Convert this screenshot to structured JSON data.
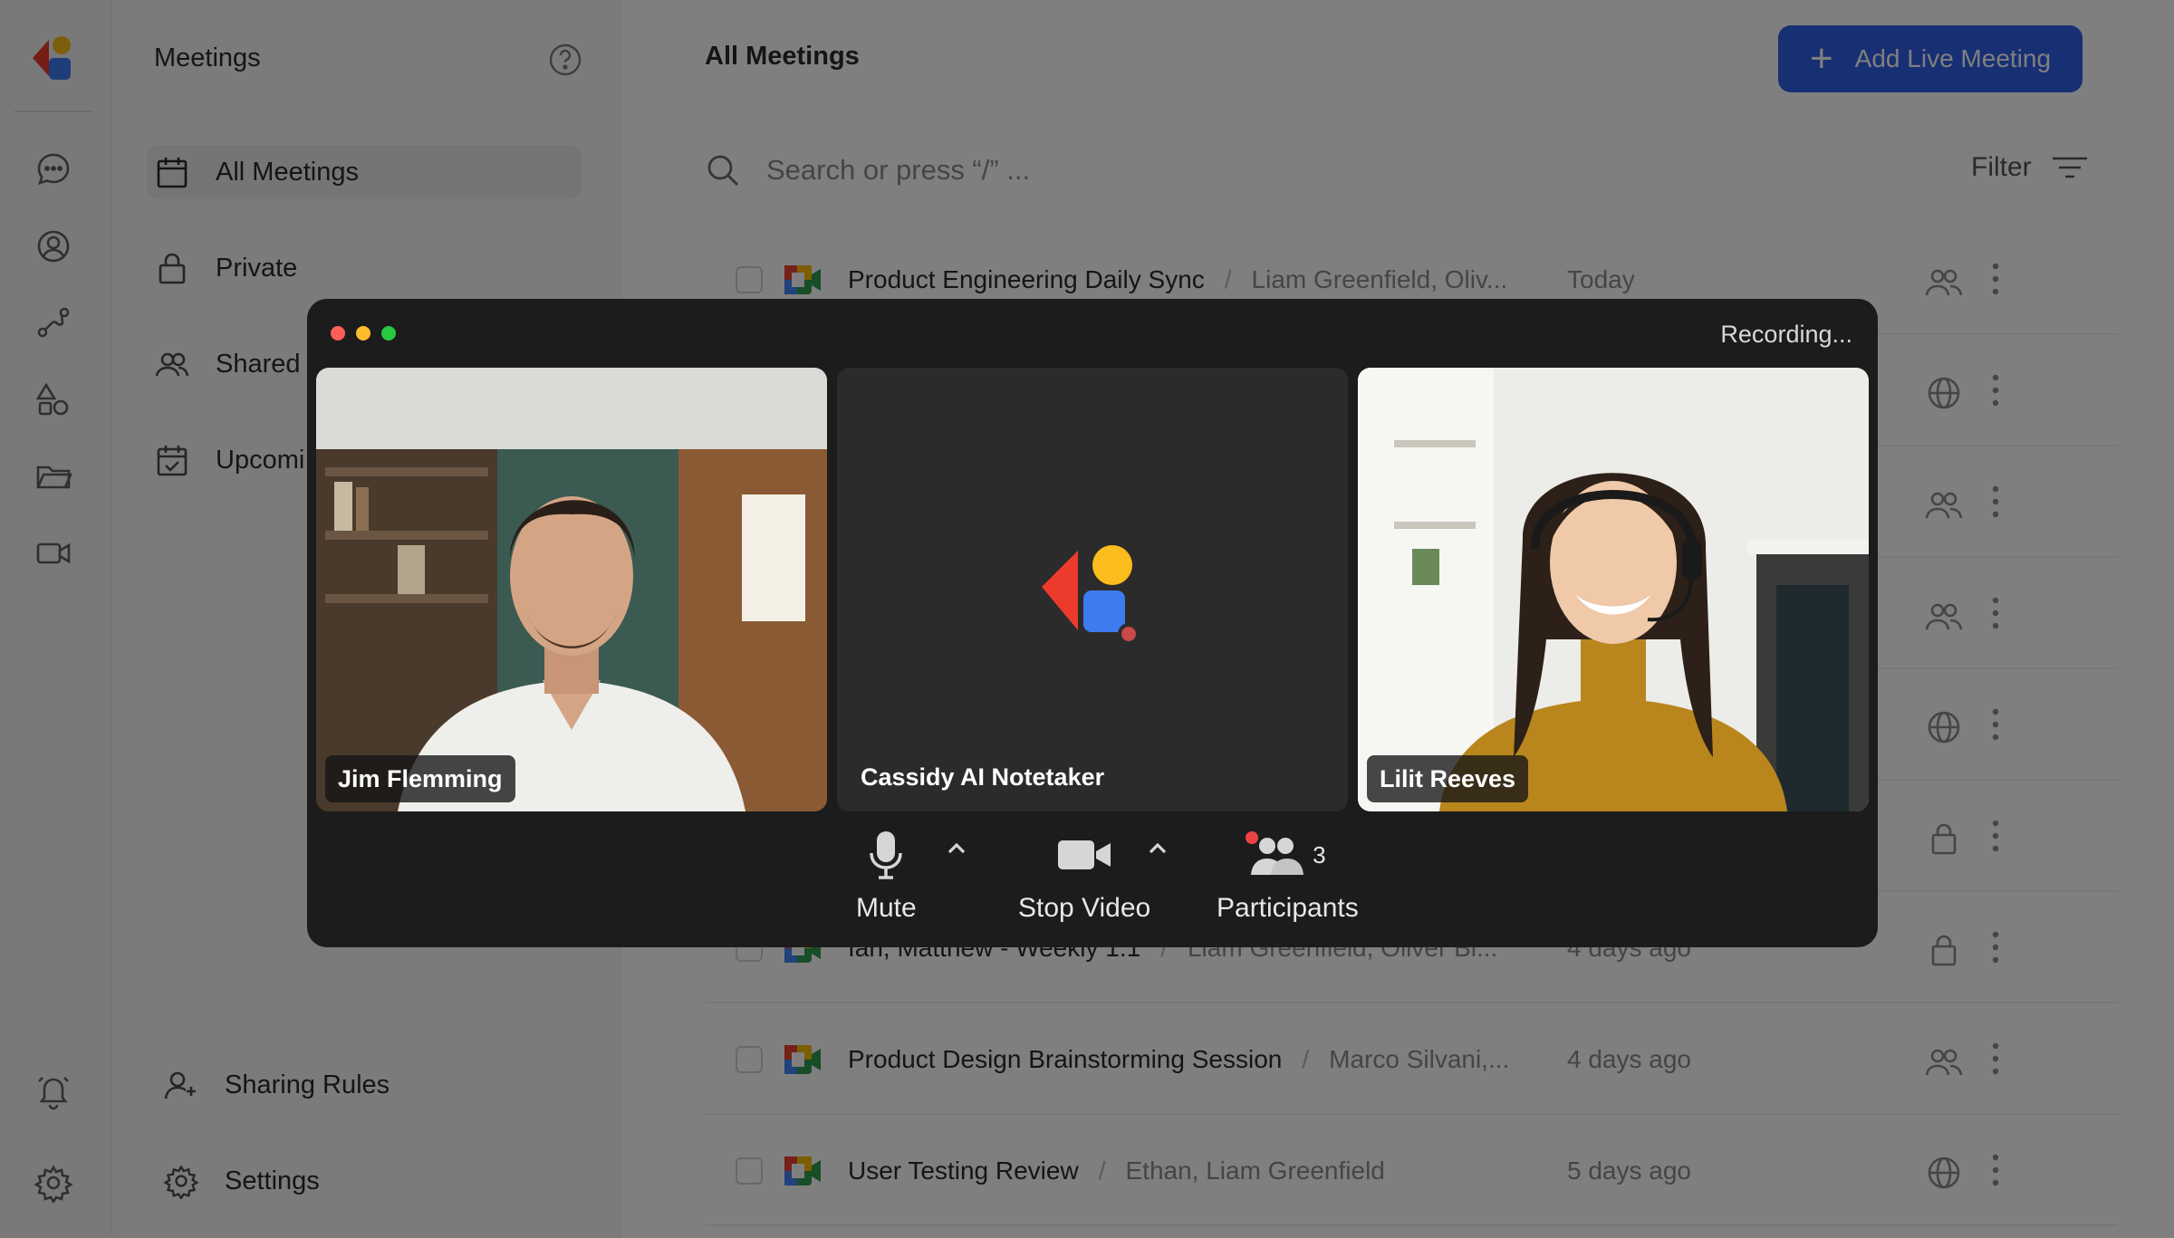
{
  "colors": {
    "brand_red": "#ec3a2c",
    "brand_yellow": "#fbbd1b",
    "brand_blue": "#3f7bf0",
    "accent_button": "#2f5ee6",
    "record_dot": "#ec4444",
    "window_close": "#ff5f57",
    "window_min": "#febc2e",
    "window_max": "#28c840"
  },
  "rail": {
    "icons": [
      "chat-icon",
      "user-circle-icon",
      "route-icon",
      "shapes-icon",
      "folder-icon",
      "video-icon",
      "bell-icon",
      "gear-icon"
    ]
  },
  "sidebar": {
    "title": "Meetings",
    "items": [
      {
        "label": "All Meetings",
        "icon": "calendar-icon"
      },
      {
        "label": "Private",
        "icon": "lock-icon"
      },
      {
        "label": "Shared",
        "icon": "people-icon"
      },
      {
        "label": "Upcomi",
        "icon": "calendar-check-icon"
      }
    ],
    "footer": [
      {
        "label": "Sharing Rules",
        "icon": "user-plus-icon"
      },
      {
        "label": "Settings",
        "icon": "gear-icon"
      }
    ]
  },
  "main": {
    "title": "All Meetings",
    "add_button": "Add Live Meeting",
    "search_placeholder": "Search or press “/” ...",
    "filter_label": "Filter",
    "rows": [
      {
        "title": "Product Engineering Daily Sync",
        "participants": "Liam Greenfield, Oliv...",
        "date": "Today",
        "visibility": "shared"
      },
      {
        "title": "",
        "participants": "",
        "date": "",
        "visibility": "public"
      },
      {
        "title": "",
        "participants": "",
        "date": "",
        "visibility": "shared"
      },
      {
        "title": "",
        "participants": "",
        "date": "",
        "visibility": "shared"
      },
      {
        "title": "",
        "participants": "",
        "date": "",
        "visibility": "public"
      },
      {
        "title": "",
        "participants": "",
        "date": "",
        "visibility": "private"
      },
      {
        "title": "Ian, Matthew - Weekly 1:1",
        "participants": "Liam Greenfield, Oliver Bl...",
        "date": "4 days ago",
        "visibility": "private"
      },
      {
        "title": "Product Design Brainstorming Session",
        "participants": "Marco Silvani,...",
        "date": "4 days ago",
        "visibility": "shared"
      },
      {
        "title": "User Testing Review",
        "participants": "Ethan, Liam Greenfield",
        "date": "5 days ago",
        "visibility": "public"
      }
    ]
  },
  "meeting": {
    "status": "Recording...",
    "tiles": [
      {
        "name": "Jim Flemming"
      },
      {
        "name": "Cassidy AI Notetaker"
      },
      {
        "name": "Lilit Reeves"
      }
    ],
    "controls": {
      "mute": "Mute",
      "video": "Stop Video",
      "participants": "Participants",
      "participant_count": "3"
    }
  }
}
